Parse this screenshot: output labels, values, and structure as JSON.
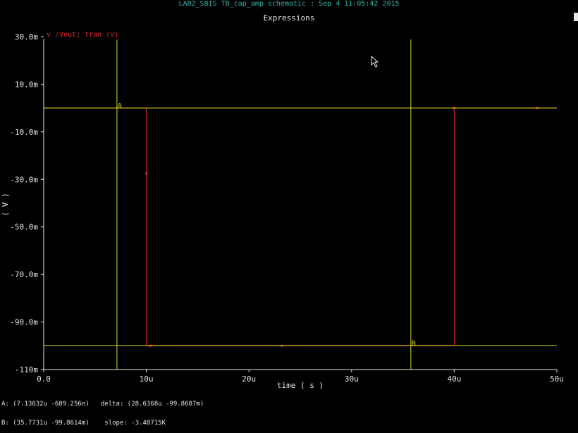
{
  "window": {
    "title": "LAB2_SBIS TB_cap_amp schematic : Sep  4 11:05:42 2015",
    "subtitle": "Expressions"
  },
  "readout": {
    "a_line": "A: (7.13632u -689.256n)   delta: (28.6368u -99.8607m)",
    "b_line": "B: (35.7731u -99.8614m)    slope: -3.48715K"
  },
  "colors": {
    "background": "#000000",
    "trace": "#d8282d",
    "marker": "#d8d82a",
    "axis": "#e6e6e6"
  },
  "chart_data": {
    "type": "line",
    "legend": "v /Vout; tran (V)",
    "xlabel": "time ( s )",
    "ylabel": "( V )",
    "xlim": [
      0,
      50
    ],
    "ylim": [
      -110,
      30
    ],
    "x_ticks": [
      {
        "v": 0,
        "label": "0.0"
      },
      {
        "v": 10,
        "label": "10u"
      },
      {
        "v": 20,
        "label": "20u"
      },
      {
        "v": 30,
        "label": "30u"
      },
      {
        "v": 40,
        "label": "40u"
      },
      {
        "v": 50,
        "label": "50u"
      }
    ],
    "y_ticks": [
      {
        "v": 30,
        "label": "30.0m"
      },
      {
        "v": 10,
        "label": "10.0m"
      },
      {
        "v": -10,
        "label": "-10.0m"
      },
      {
        "v": -30,
        "label": "-30.0m"
      },
      {
        "v": -50,
        "label": "-50.0m"
      },
      {
        "v": -70,
        "label": "-70.0m"
      },
      {
        "v": -90,
        "label": "-90.0m"
      },
      {
        "v": -110,
        "label": "-110m"
      }
    ],
    "series": [
      {
        "points": [
          [
            0,
            0
          ],
          [
            10,
            0
          ],
          [
            10,
            -100
          ],
          [
            40,
            -100
          ],
          [
            40,
            0
          ],
          [
            50,
            0
          ]
        ],
        "marks": [
          [
            10,
            -27.5
          ],
          [
            10.4,
            -100
          ],
          [
            23.2,
            -100
          ],
          [
            40,
            0
          ],
          [
            48.1,
            0
          ]
        ]
      }
    ],
    "markers": [
      {
        "name": "A",
        "x": 7.13632,
        "y": 0
      },
      {
        "name": "B",
        "x": 35.7731,
        "y": -99.8614
      }
    ]
  }
}
